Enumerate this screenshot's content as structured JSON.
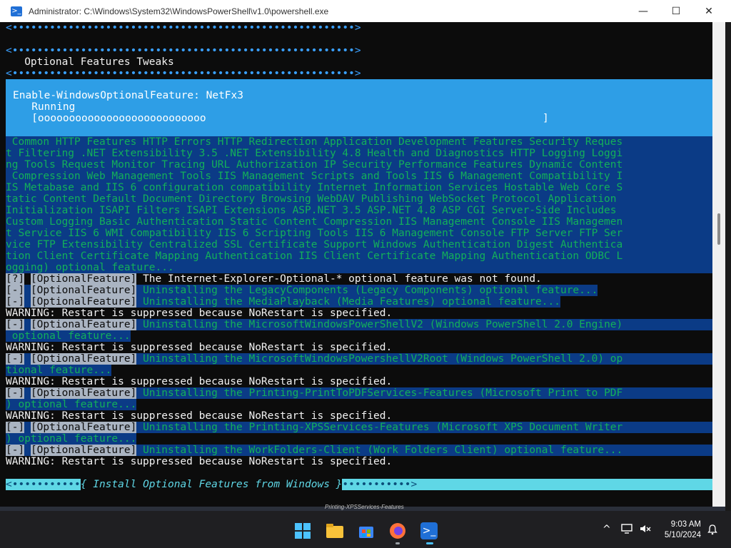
{
  "window": {
    "title": "Administrator: C:\\Windows\\System32\\WindowsPowerShell\\v1.0\\powershell.exe",
    "controls": {
      "minimize": "—",
      "maximize": "☐",
      "close": "✕"
    }
  },
  "console": {
    "separator_short": "<•••••••••••••••••••••••••••••••••••••••••••••••••••••••>",
    "section_title": "   Optional Features Tweaks",
    "progress": {
      "activity": "Enable-WindowsOptionalFeature: NetFx3",
      "status": "   Running",
      "bar": "   [ooooooooooooooooooooooooooo                                                      ]",
      "fraction": 0.3
    },
    "feature_list": [
      " Common HTTP Features HTTP Errors HTTP Redirection Application Development Features Security Reques",
      "t Filtering .NET Extensibility 3.5 .NET Extensibility 4.8 Health and Diagnostics HTTP Logging Loggi",
      "ng Tools Request Monitor Tracing URL Authorization IP Security Performance Features Dynamic Content",
      " Compression Web Management Tools IIS Management Scripts and Tools IIS 6 Management Compatibility I",
      "IS Metabase and IIS 6 configuration compatibility Internet Information Services Hostable Web Core S",
      "tatic Content Default Document Directory Browsing WebDAV Publishing WebSocket Protocol Application",
      "Initialization ISAPI Filters ISAPI Extensions ASP.NET 3.5 ASP.NET 4.8 ASP CGI Server-Side Includes",
      "Custom Logging Basic Authentication Static Content Compression IIS Management Console IIS Managemen",
      "t Service IIS 6 WMI Compatibility IIS 6 Scripting Tools IIS 6 Management Console FTP Server FTP Ser",
      "vice FTP Extensibility Centralized SSL Certificate Support Windows Authentication Digest Authentica",
      "tion Client Certificate Mapping Authentication IIS Client Certificate Mapping Authentication ODBC L",
      "ogging) optional feature..."
    ],
    "tag": "[OptionalFeature]",
    "not_found": {
      "marker": "[?]",
      "text": " The Internet-Explorer-Optional-* optional feature was not found."
    },
    "minus_marker": "[-]",
    "uninstall_legacy": " Uninstalling the LegacyComponents (Legacy Components) optional feature...",
    "uninstall_media": " Uninstalling the MediaPlayback (Media Features) optional feature...",
    "warning": "WARNING: Restart is suppressed because NoRestart is specified.",
    "uninstall_ps2_a": " Uninstalling the MicrosoftWindowsPowerShellV2 (Windows PowerShell 2.0 Engine)",
    "uninstall_ps2_b": " optional feature...",
    "uninstall_ps2root_a": " Uninstalling the MicrosoftWindowsPowershellV2Root (Windows PowerShell 2.0) op",
    "uninstall_ps2root_b": "tional feature...",
    "uninstall_pdf_a": " Uninstalling the Printing-PrintToPDFServices-Features (Microsoft Print to PDF",
    "uninstall_pdf_b": ") optional feature...",
    "uninstall_xps_a": " Uninstalling the Printing-XPSServices-Features (Microsoft XPS Document Writer",
    "uninstall_xps_b": ") optional feature...",
    "uninstall_workfolders": " Uninstalling the WorkFolders-Client (Work Folders Client) optional feature...",
    "banner": {
      "left": "<•••••••••••",
      "text": "{ Install Optional Features from Windows }",
      "right": "•••••••••••>"
    }
  },
  "behind_window_text": "Printing-XPSServices-Features",
  "taskbar": {
    "clock_time": "9:03 AM",
    "clock_date": "5/10/2024",
    "chevron": "^",
    "apps": [
      "start-button",
      "file-explorer",
      "microsoft-store",
      "firefox",
      "powershell"
    ]
  },
  "colors": {
    "console_bg": "#0c0c0c",
    "progress_bg": "#2e9ee6",
    "list_bg": "#0b3b86",
    "green_text": "#13b05a",
    "cyan_banner": "#5fd7e6"
  }
}
